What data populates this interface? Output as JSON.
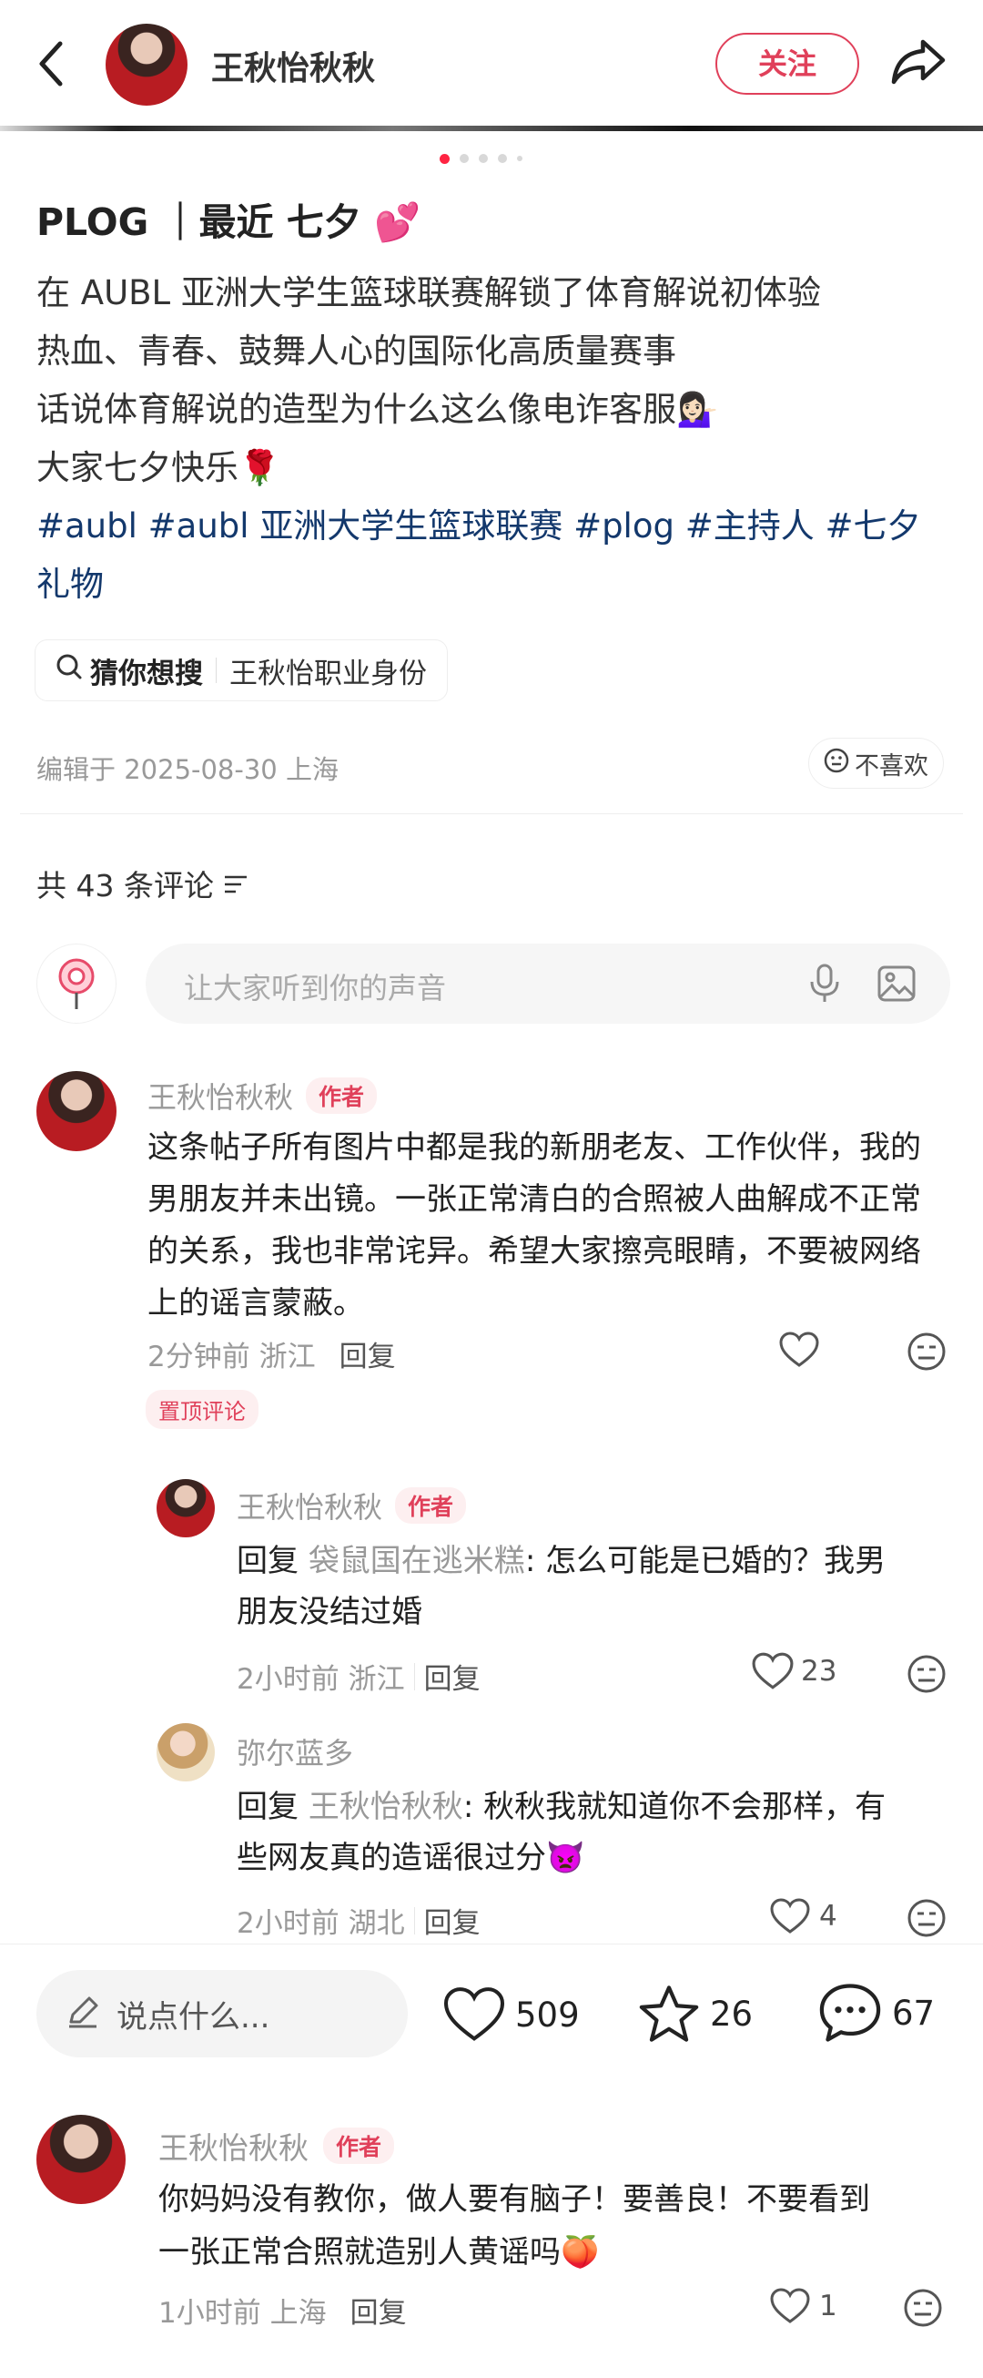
{
  "header": {
    "username": "王秋怡秋秋",
    "follow_label": "关注"
  },
  "post": {
    "title": "PLOG ｜最近 七夕",
    "lines": [
      "在 AUBL 亚洲大学生篮球联赛解锁了体育解说初体验",
      "热血、青春、鼓舞人心的国际化高质量赛事",
      "话说体育解说的造型为什么这么像电诈客服",
      "大家七夕快乐"
    ],
    "tags_line1": "#aubl #aubl 亚洲大学生篮球联赛 #plog #主持人 #七夕",
    "tags_line2": "礼物",
    "search_hint_label": "猜你想搜",
    "search_hint_query": "王秋怡职业身份",
    "edit_info": "编辑于 2025-08-30 上海",
    "dislike_label": "不喜欢",
    "emoji_heart": "💕",
    "emoji_woman": "💁🏻‍♀️",
    "emoji_rose": "🌹"
  },
  "comments_header": {
    "count_label": "共 43 条评论"
  },
  "comment_input": {
    "placeholder": "让大家听到你的声音"
  },
  "comments": [
    {
      "user": "王秋怡秋秋",
      "badge": "作者",
      "lines": [
        "这条帖子所有图片中都是我的新朋老友、工作伙伴，我的",
        "男朋友并未出镜。一张正常清白的合照被人曲解成不正常",
        "的关系，我也非常诧异。希望大家擦亮眼睛，不要被网络",
        "上的谣言蒙蔽。"
      ],
      "time": "2分钟前 浙江",
      "reply": "回复",
      "pinned": "置顶评论"
    },
    {
      "user": "王秋怡秋秋",
      "badge": "作者",
      "reply_prefix": "回复",
      "reply_to": "袋鼠国在逃米糕",
      "line1": ": 怎么可能是已婚的？我男",
      "line2": "朋友没结过婚",
      "time": "2小时前 浙江",
      "reply": "回复",
      "likes": "23"
    },
    {
      "user": "弥尔蓝多",
      "reply_prefix": "回复",
      "reply_to": "王秋怡秋秋",
      "line1": ": 秋秋我就知道你不会那样，有",
      "line2": "些网友真的造谣很过分",
      "emoji": "👿",
      "time": "2小时前 湖北",
      "reply": "回复",
      "likes": "4"
    },
    {
      "user": "王秋怡秋秋",
      "badge": "作者",
      "line1": "你妈妈没有教你，做人要有脑子！要善良！不要看到",
      "line2": "一张正常合照就造别人黄谣吗",
      "emoji": "🍑",
      "time": "1小时前 上海",
      "reply": "回复",
      "likes": "1"
    }
  ],
  "bottom_bar": {
    "placeholder": "说点什么...",
    "likes": "509",
    "stars": "26",
    "comments": "67"
  }
}
